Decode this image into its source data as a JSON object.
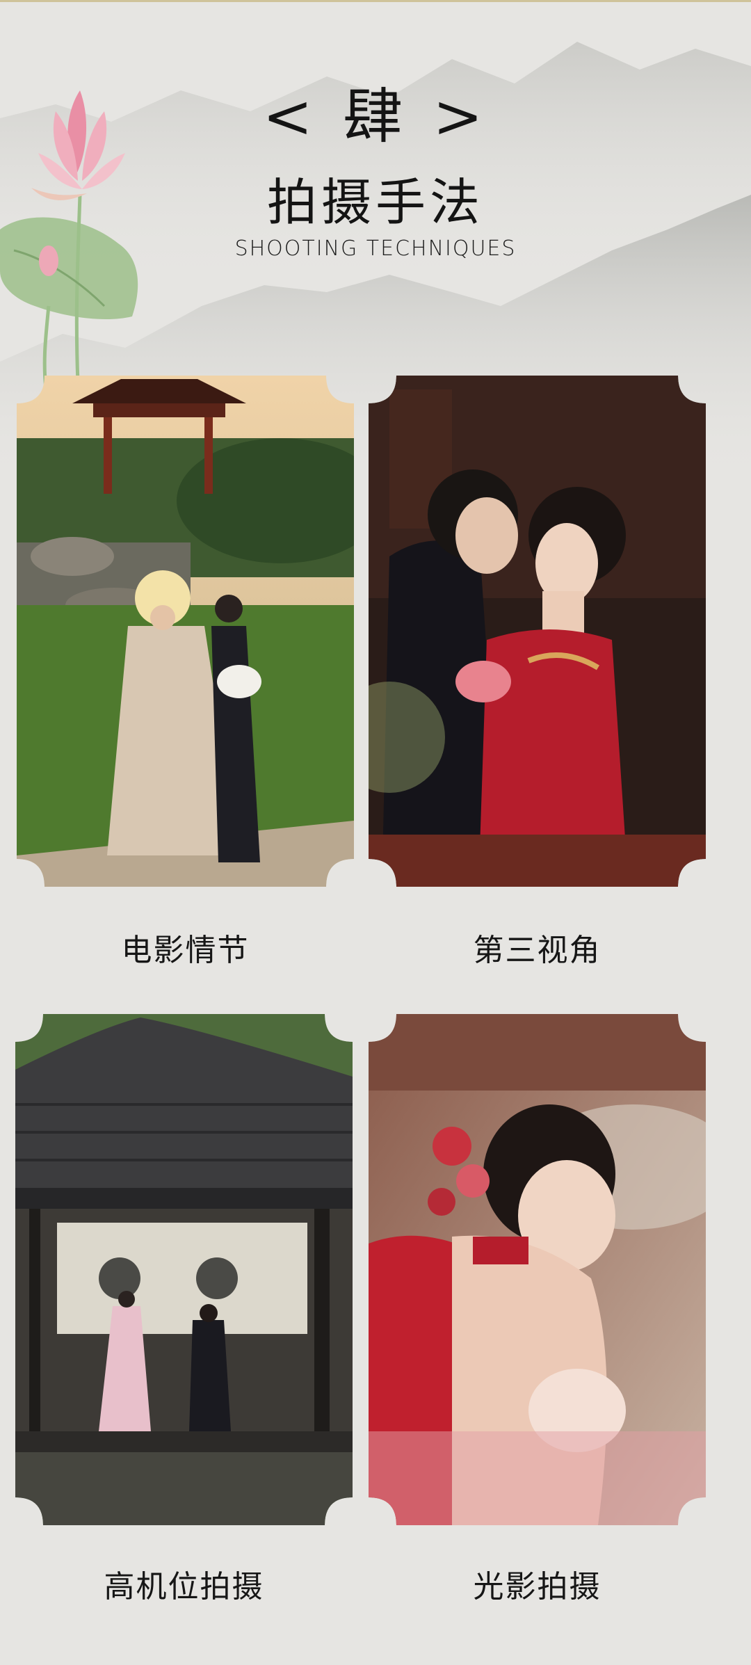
{
  "header": {
    "number": "< 肆 >",
    "title_cn": "拍摄手法",
    "title_en": "SHOOTING TECHNIQUES"
  },
  "colors": {
    "background": "#e6e5e2",
    "text": "#141414",
    "lotus_pink": "#e98fa5",
    "leaf_green": "#9cc08a"
  },
  "sections": [
    {
      "caption": "电影情节",
      "image": "garden-pavilion-couple-photo"
    },
    {
      "caption": "第三视角",
      "image": "couple-red-dress-embrace-photo"
    },
    {
      "caption": "高机位拍摄",
      "image": "courtyard-pavilion-roof-photo"
    },
    {
      "caption": "光影拍摄",
      "image": "woman-red-flowers-hair-photo"
    }
  ]
}
